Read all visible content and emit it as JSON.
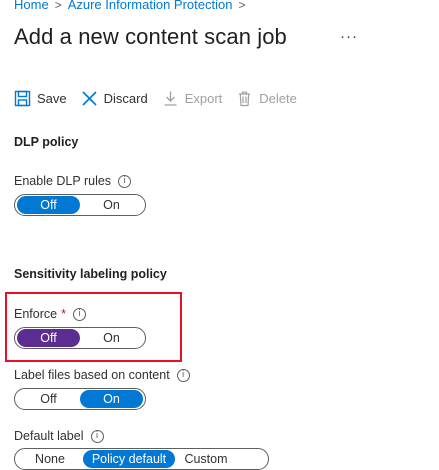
{
  "breadcrumb": {
    "home": "Home",
    "parent": "Azure Information Protection",
    "separator": ">"
  },
  "page": {
    "title": "Add a new content scan job",
    "more_label": "···"
  },
  "toolbar": {
    "save": "Save",
    "discard": "Discard",
    "export": "Export",
    "delete": "Delete"
  },
  "dlp": {
    "heading": "DLP policy",
    "enable_label": "Enable DLP rules",
    "options": [
      "Off",
      "On"
    ],
    "selected": "Off"
  },
  "sensitivity": {
    "heading": "Sensitivity labeling policy",
    "enforce_label": "Enforce",
    "required_mark": "*",
    "enforce_options": [
      "Off",
      "On"
    ],
    "enforce_selected": "Off",
    "label_files_label": "Label files based on content",
    "label_files_options": [
      "Off",
      "On"
    ],
    "label_files_selected": "On",
    "default_label_label": "Default label",
    "default_label_options": [
      "None",
      "Policy default",
      "Custom"
    ],
    "default_label_selected": "Policy default"
  },
  "info_glyph": "i",
  "colors": {
    "accent": "#0078d4",
    "enforce_selected": "#5c2d91",
    "highlight": "#e81123",
    "required": "#a4262c"
  }
}
